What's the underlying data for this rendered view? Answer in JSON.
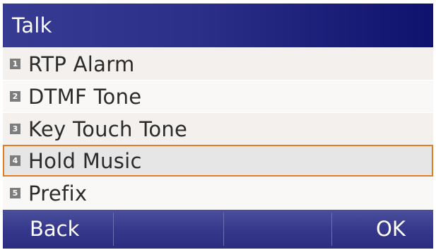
{
  "header": {
    "title": "Talk"
  },
  "menu": {
    "items": [
      {
        "number": "1",
        "label": "RTP Alarm"
      },
      {
        "number": "2",
        "label": "DTMF Tone"
      },
      {
        "number": "3",
        "label": "Key Touch Tone"
      },
      {
        "number": "4",
        "label": "Hold Music",
        "selected": true
      },
      {
        "number": "5",
        "label": "Prefix"
      }
    ]
  },
  "softkeys": {
    "left": "Back",
    "mid1": "",
    "mid2": "",
    "right": "OK"
  },
  "colors": {
    "title_bar": "#2c2f88",
    "softkey_bar": "#34378a",
    "selection_border": "#e27d24",
    "number_badge": "#7d7d7d"
  }
}
